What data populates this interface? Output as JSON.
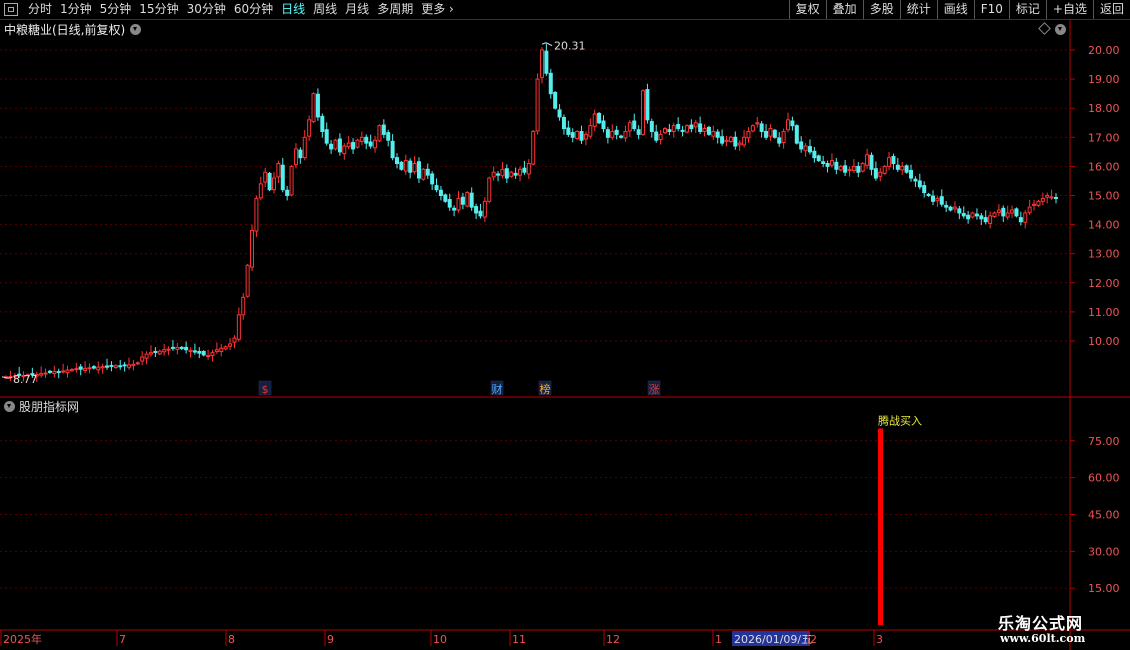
{
  "toolbar": {
    "periods": [
      {
        "label": "分时",
        "active": false
      },
      {
        "label": "1分钟",
        "active": false
      },
      {
        "label": "5分钟",
        "active": false
      },
      {
        "label": "15分钟",
        "active": false
      },
      {
        "label": "30分钟",
        "active": false
      },
      {
        "label": "60分钟",
        "active": false
      },
      {
        "label": "日线",
        "active": true
      },
      {
        "label": "周线",
        "active": false
      },
      {
        "label": "月线",
        "active": false
      },
      {
        "label": "多周期",
        "active": false
      }
    ],
    "more_label": "更多",
    "buttons": [
      "复权",
      "叠加",
      "多股",
      "统计",
      "画线",
      "F10",
      "标记",
      "+自选",
      "返回"
    ]
  },
  "stock": {
    "title": "中粮糖业(日线,前复权)"
  },
  "chart_data": [
    {
      "type": "candlestick",
      "ylim": [
        9.0,
        20.5
      ],
      "y_ticks": [
        "10.00",
        "11.00",
        "12.00",
        "13.00",
        "14.00",
        "15.00",
        "16.00",
        "17.00",
        "18.00",
        "19.00",
        "20.00"
      ],
      "max_label": "20.31",
      "min_label": "8.77",
      "event_markers": [
        {
          "label": "$",
          "color": "#e33"
        },
        {
          "label": "财",
          "color": "#5af"
        },
        {
          "label": "榜",
          "color": "#fa3"
        },
        {
          "label": "涨",
          "color": "#e33"
        }
      ],
      "price_path": [
        8.77,
        8.78,
        8.8,
        8.82,
        8.81,
        8.84,
        8.86,
        8.85,
        8.88,
        8.9,
        8.92,
        8.95,
        8.93,
        8.97,
        9.0,
        9.02,
        9.05,
        9.03,
        9.06,
        9.08,
        9.07,
        9.1,
        9.12,
        9.1,
        9.13,
        9.15,
        9.14,
        9.16,
        9.18,
        9.2,
        9.25,
        9.45,
        9.55,
        9.6,
        9.62,
        9.65,
        9.7,
        9.72,
        9.75,
        9.78,
        9.74,
        9.7,
        9.68,
        9.62,
        9.58,
        9.52,
        9.5,
        9.6,
        9.7,
        9.75,
        9.8,
        9.9,
        10.1,
        10.9,
        11.5,
        12.6,
        13.8,
        14.9,
        15.4,
        15.8,
        15.2,
        15.6,
        16.1,
        15.2,
        15.0,
        16.0,
        16.6,
        16.3,
        17.0,
        17.6,
        18.5,
        17.7,
        17.2,
        16.8,
        16.6,
        16.9,
        16.5,
        16.7,
        16.8,
        16.6,
        16.9,
        17.0,
        16.8,
        16.7,
        16.9,
        17.4,
        17.1,
        16.9,
        16.3,
        16.1,
        15.9,
        16.2,
        15.8,
        16.1,
        15.6,
        15.9,
        15.7,
        15.4,
        15.2,
        15.0,
        14.8,
        14.6,
        14.5,
        14.9,
        14.7,
        15.1,
        14.6,
        14.4,
        14.3,
        14.8,
        15.6,
        15.8,
        15.7,
        15.9,
        15.6,
        15.8,
        15.7,
        15.9,
        15.8,
        16.1,
        17.2,
        19.0,
        20.0,
        19.2,
        18.5,
        18.0,
        17.7,
        17.3,
        17.1,
        17.0,
        17.2,
        16.9,
        17.1,
        17.4,
        17.8,
        17.5,
        17.3,
        17.0,
        17.2,
        17.1,
        17.0,
        17.2,
        17.5,
        17.3,
        17.1,
        18.6,
        17.6,
        17.2,
        16.9,
        17.1,
        17.3,
        17.2,
        17.4,
        17.3,
        17.2,
        17.4,
        17.3,
        17.5,
        17.2,
        17.3,
        17.1,
        17.2,
        17.0,
        16.8,
        16.9,
        17.0,
        16.7,
        16.8,
        17.0,
        17.2,
        17.4,
        17.5,
        17.2,
        17.0,
        17.3,
        17.0,
        16.8,
        17.2,
        17.6,
        17.4,
        16.8,
        16.6,
        16.7,
        16.5,
        16.3,
        16.2,
        16.1,
        16.0,
        16.2,
        15.9,
        16.0,
        15.8,
        15.9,
        16.0,
        15.8,
        16.1,
        16.4,
        15.9,
        15.6,
        15.8,
        16.0,
        16.3,
        16.1,
        15.9,
        16.0,
        15.8,
        15.6,
        15.5,
        15.3,
        15.1,
        15.0,
        14.8,
        14.9,
        14.7,
        14.6,
        14.5,
        14.6,
        14.4,
        14.3,
        14.2,
        14.4,
        14.3,
        14.2,
        14.1,
        14.3,
        14.4,
        14.5,
        14.3,
        14.4,
        14.5,
        14.3,
        14.1,
        14.4,
        14.6,
        14.7,
        14.8,
        14.9,
        15.0,
        14.95,
        14.9
      ]
    },
    {
      "type": "bar",
      "title": "股朋指标网",
      "ylim": [
        0,
        90
      ],
      "y_ticks": [
        "15.00",
        "30.00",
        "45.00",
        "60.00",
        "75.00"
      ],
      "signal_value": 80,
      "signal_label": "腾战买入",
      "signal_color": "#f00"
    }
  ],
  "x_axis": {
    "labels": [
      "2025年",
      "7",
      "8",
      "9",
      "10",
      "11",
      "12",
      "1",
      "2026/01/09/五",
      "2",
      "3"
    ]
  },
  "watermark": {
    "title": "乐淘公式网",
    "url": "www.60lt.com"
  }
}
